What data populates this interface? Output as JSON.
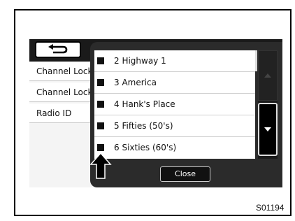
{
  "background_rows": [
    {
      "label": "Channel Lock"
    },
    {
      "label": "Channel Lock"
    },
    {
      "label": "Radio ID"
    }
  ],
  "popup": {
    "items": [
      {
        "label": "2  Highway 1"
      },
      {
        "label": "3  America"
      },
      {
        "label": "4  Hank's Place"
      },
      {
        "label": "5  Fifties (50's)"
      },
      {
        "label": "6  Sixties (60's)"
      }
    ],
    "close_label": "Close"
  },
  "icons": {
    "back": "return-arrow-icon",
    "scroll_up": "triangle-up-icon",
    "scroll_down": "triangle-down-icon",
    "pointer": "up-arrow-callout-icon"
  },
  "figure_code": "S01194"
}
